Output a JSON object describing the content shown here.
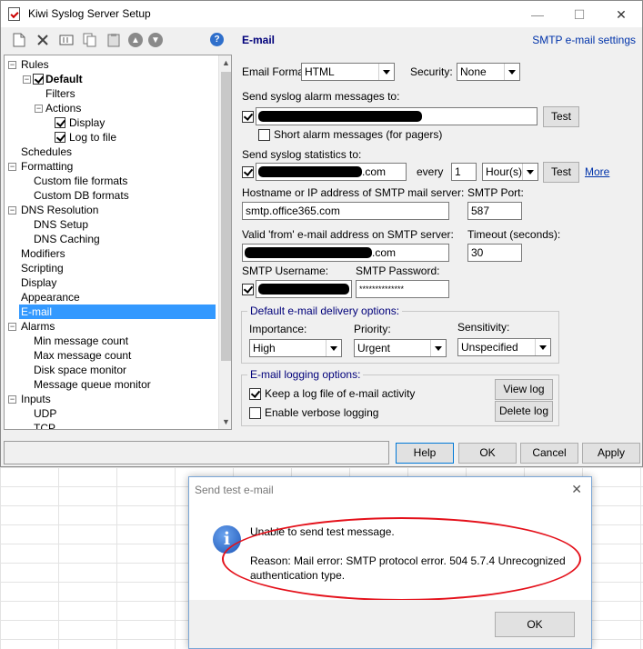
{
  "window": {
    "title": "Kiwi Syslog Server Setup",
    "controls": {
      "minimize": "—",
      "maximize": "☐",
      "close": "✕"
    }
  },
  "toolbar": {
    "help_glyph": "?"
  },
  "section": {
    "title": "E-mail",
    "link": "SMTP e-mail settings"
  },
  "tree": {
    "items": [
      {
        "label": "Rules"
      },
      {
        "label": "Default"
      },
      {
        "label": "Filters"
      },
      {
        "label": "Actions"
      },
      {
        "label": "Display"
      },
      {
        "label": "Log to file"
      },
      {
        "label": "Schedules"
      },
      {
        "label": "Formatting"
      },
      {
        "label": "Custom file formats"
      },
      {
        "label": "Custom DB formats"
      },
      {
        "label": "DNS Resolution"
      },
      {
        "label": "DNS Setup"
      },
      {
        "label": "DNS Caching"
      },
      {
        "label": "Modifiers"
      },
      {
        "label": "Scripting"
      },
      {
        "label": "Display"
      },
      {
        "label": "Appearance"
      },
      {
        "label": "E-mail"
      },
      {
        "label": "Alarms"
      },
      {
        "label": "Min message count"
      },
      {
        "label": "Max message count"
      },
      {
        "label": "Disk space monitor"
      },
      {
        "label": "Message queue monitor"
      },
      {
        "label": "Inputs"
      },
      {
        "label": "UDP"
      },
      {
        "label": "TCP"
      }
    ],
    "selected": "E-mail"
  },
  "form": {
    "email_format_label": "Email Format:",
    "email_format_value": "HTML",
    "security_label": "Security:",
    "security_value": "None",
    "alarm_label": "Send syslog alarm messages to:",
    "alarm_test": "Test",
    "short_alarm_label": "Short alarm messages (for pagers)",
    "stats_label": "Send syslog statistics to:",
    "stats_suffix": ".com",
    "every_label": "every",
    "every_value": "1",
    "unit_value": "Hour(s)",
    "stats_test": "Test",
    "more_link": "More",
    "host_label": "Hostname or IP address of SMTP mail server:",
    "host_value": "smtp.office365.com",
    "port_label": "SMTP Port:",
    "port_value": "587",
    "from_label": "Valid 'from' e-mail address on SMTP server:",
    "from_suffix": ".com",
    "timeout_label": "Timeout (seconds):",
    "timeout_value": "30",
    "username_label": "SMTP Username:",
    "password_label": "SMTP Password:",
    "password_value": "**************"
  },
  "delivery": {
    "title": "Default e-mail delivery options:",
    "importance_label": "Importance:",
    "importance_value": "High",
    "priority_label": "Priority:",
    "priority_value": "Urgent",
    "sensitivity_label": "Sensitivity:",
    "sensitivity_value": "Unspecified"
  },
  "logging": {
    "title": "E-mail logging options:",
    "keep_log": "Keep a log file of e-mail activity",
    "verbose": "Enable verbose logging",
    "view_log": "View log",
    "delete_log": "Delete log"
  },
  "buttons": {
    "help": "Help",
    "ok": "OK",
    "cancel": "Cancel",
    "apply": "Apply"
  },
  "dialog": {
    "title": "Send test e-mail",
    "close": "✕",
    "icon_glyph": "i",
    "message": "Unable to send test message.",
    "reason": "Reason: Mail error: SMTP protocol error. 504 5.7.4 Unrecognized authentication type.",
    "ok": "OK"
  },
  "colors": {
    "selection": "#3399ff",
    "group_title": "#00007a",
    "link": "#0033aa",
    "annotation": "#e4101a"
  }
}
